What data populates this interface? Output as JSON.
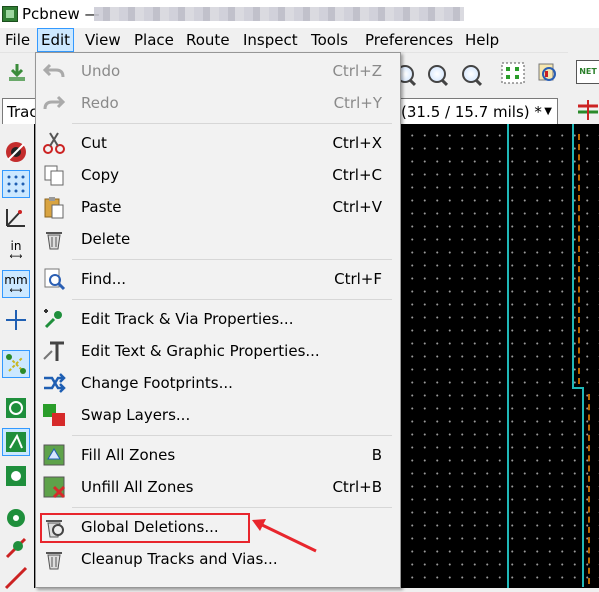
{
  "window": {
    "title": "Pcbnew —"
  },
  "menubar": {
    "items": [
      {
        "label": "File"
      },
      {
        "label": "Edit"
      },
      {
        "label": "View"
      },
      {
        "label": "Place"
      },
      {
        "label": "Route"
      },
      {
        "label": "Inspect"
      },
      {
        "label": "Tools"
      },
      {
        "label": "Preferences"
      },
      {
        "label": "Help"
      }
    ]
  },
  "toolbar": {
    "track_select": "Trac",
    "via_select": "(31.5 / 15.7 mils) *",
    "net_label": "NET"
  },
  "left_toolbar": {
    "units_in": "in",
    "units_mm": "mm"
  },
  "edit_menu": {
    "items": [
      {
        "label": "Undo",
        "shortcut": "Ctrl+Z",
        "icon": "undo-icon",
        "disabled": true
      },
      {
        "label": "Redo",
        "shortcut": "Ctrl+Y",
        "icon": "redo-icon",
        "disabled": true
      },
      {
        "label": "Cut",
        "shortcut": "Ctrl+X",
        "icon": "scissors-icon"
      },
      {
        "label": "Copy",
        "shortcut": "Ctrl+C",
        "icon": "copy-icon"
      },
      {
        "label": "Paste",
        "shortcut": "Ctrl+V",
        "icon": "paste-icon"
      },
      {
        "label": "Delete",
        "shortcut": "",
        "icon": "trash-icon"
      },
      {
        "label": "Find...",
        "shortcut": "Ctrl+F",
        "icon": "find-icon"
      },
      {
        "label": "Edit Track & Via Properties...",
        "shortcut": "",
        "icon": "track-via-icon"
      },
      {
        "label": "Edit Text & Graphic Properties...",
        "shortcut": "",
        "icon": "text-graphic-icon"
      },
      {
        "label": "Change Footprints...",
        "shortcut": "",
        "icon": "exchange-icon"
      },
      {
        "label": "Swap Layers...",
        "shortcut": "",
        "icon": "swap-layers-icon"
      },
      {
        "label": "Fill All Zones",
        "shortcut": "B",
        "icon": "fill-zones-icon"
      },
      {
        "label": "Unfill All Zones",
        "shortcut": "Ctrl+B",
        "icon": "unfill-zones-icon"
      },
      {
        "label": "Global Deletions...",
        "shortcut": "",
        "icon": "global-delete-icon"
      },
      {
        "label": "Cleanup Tracks and Vias...",
        "shortcut": "",
        "icon": "cleanup-icon"
      }
    ]
  },
  "annotation": {
    "highlight_color": "#e8262d"
  }
}
